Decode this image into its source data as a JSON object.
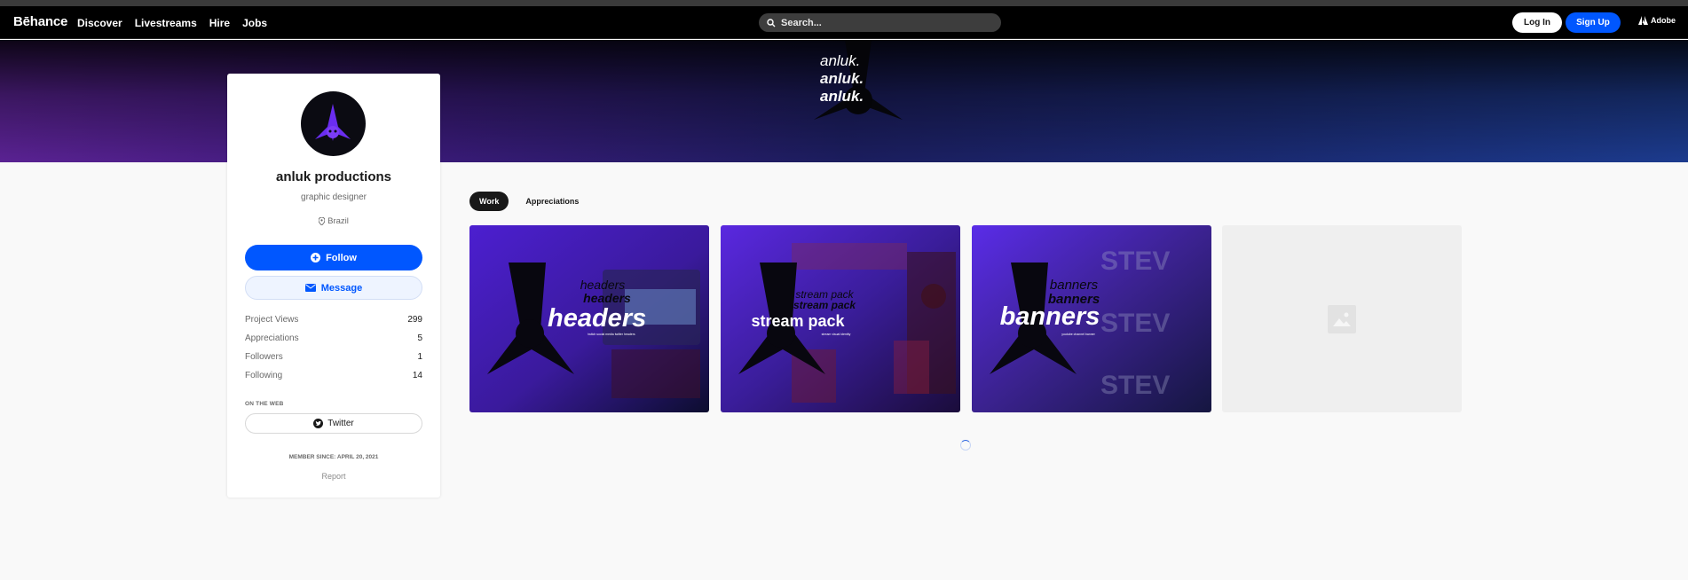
{
  "header": {
    "logo": "Bēhance",
    "nav": [
      "Discover",
      "Livestreams",
      "Hire",
      "Jobs"
    ],
    "search_placeholder": "Search...",
    "login_label": "Log In",
    "signup_label": "Sign Up",
    "adobe_label": "Adobe"
  },
  "banner": {
    "texts": [
      "anluk.",
      "anluk.",
      "anluk."
    ]
  },
  "profile": {
    "name": "anluk productions",
    "occupation": "graphic designer",
    "location": "Brazil",
    "follow_label": "Follow",
    "message_label": "Message",
    "stats": [
      {
        "label": "Project Views",
        "value": "299"
      },
      {
        "label": "Appreciations",
        "value": "5"
      },
      {
        "label": "Followers",
        "value": "1"
      },
      {
        "label": "Following",
        "value": "14"
      }
    ],
    "on_the_web_label": "ON THE WEB",
    "twitter_label": "Twitter",
    "member_since": "MEMBER SINCE: APRIL 20, 2021",
    "report_label": "Report"
  },
  "tabs": [
    "Work",
    "Appreciations"
  ],
  "projects": [
    {
      "title": "headers",
      "echo": "headers",
      "caption": "twitch social media twitter headers"
    },
    {
      "title": "stream pack",
      "echo": "stream pack",
      "caption": "stream visual identity"
    },
    {
      "title": "banners",
      "echo": "banners",
      "caption": "youtube channel banner"
    },
    {
      "title": "",
      "echo": "",
      "caption": ""
    }
  ],
  "colors": {
    "brand_blue": "#0057ff",
    "nav_bg": "#000000",
    "project_purple": "#6a2df0"
  },
  "icons": [
    "search-icon",
    "location-pin-icon",
    "plus-circle-icon",
    "mail-icon",
    "twitter-icon",
    "adobe-icon",
    "image-placeholder-icon"
  ]
}
